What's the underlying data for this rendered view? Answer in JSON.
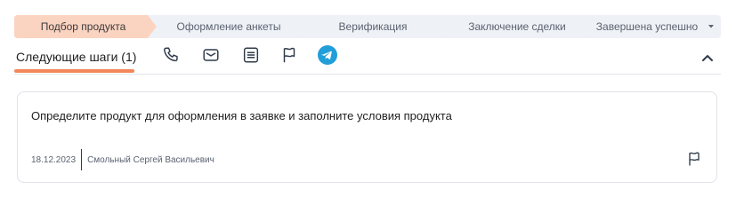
{
  "stages": [
    {
      "label": "Подбор продукта",
      "active": true
    },
    {
      "label": "Оформление анкеты",
      "active": false
    },
    {
      "label": "Верификация",
      "active": false
    },
    {
      "label": "Заключение сделки",
      "active": false
    },
    {
      "label": "Завершена успешно",
      "active": false
    }
  ],
  "colors": {
    "stage_active": "#fbd3c1",
    "stage_inactive": "#eef1f6",
    "accent": "#f2875a",
    "telegram": "#229ed9"
  },
  "tabs": {
    "next_steps": "Следующие шаги (1)",
    "icons": [
      "phone-icon",
      "mail-icon",
      "document-icon",
      "flag-icon",
      "telegram-icon"
    ]
  },
  "card": {
    "text": "Определите продукт для оформления в заявке и заполните условия продукта",
    "date": "18.12.2023",
    "author": "Смольный Сергей Васильевич"
  }
}
